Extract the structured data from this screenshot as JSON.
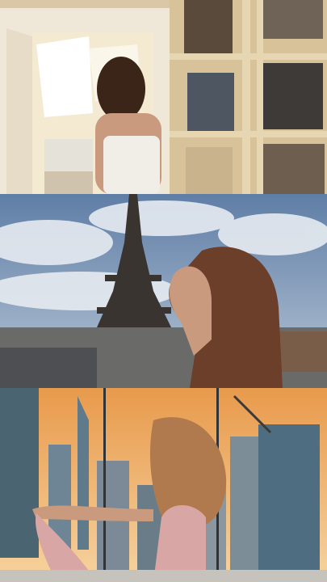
{
  "collage": {
    "layout": "vertical-triptych",
    "panels": [
      {
        "scene": "bedroom-doorway-record-shelves",
        "icon": "photo-icon"
      },
      {
        "scene": "eiffel-tower-rooftop-portrait",
        "icon": "photo-icon"
      },
      {
        "scene": "city-skyline-sunset-yoga-pose",
        "icon": "photo-icon"
      }
    ]
  },
  "palette": {
    "wall": "#e9dcc4",
    "shelf_wood": "#d8c29a",
    "sky_blue": "#6f8fb8",
    "cloud": "#dfe6ee",
    "tower": "#3a3430",
    "sunset_top": "#e89a4c",
    "sunset_bottom": "#f6d3a0",
    "skin": "#c99a7e",
    "hair": "#3b2418",
    "leggings": "#d9a6a6"
  }
}
